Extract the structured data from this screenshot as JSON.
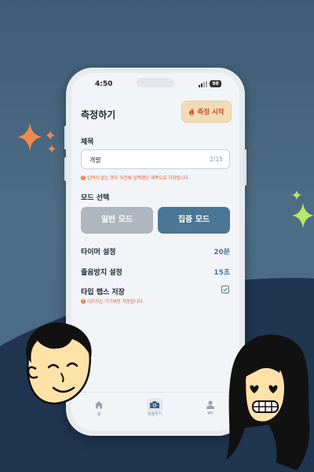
{
  "status": {
    "time": "4:50",
    "battery": "98"
  },
  "header": {
    "title": "측정하기",
    "start_button": "측정 시작"
  },
  "title_section": {
    "label": "제목",
    "value": "개발",
    "count": "2/15",
    "hint": "입력이 없는 경우 이전에 입력했던 제목으로 저장됩니다."
  },
  "mode_section": {
    "label": "모드 선택",
    "normal": "일반 모드",
    "focus": "집중 모드",
    "selected": "focus"
  },
  "settings": {
    "timer": {
      "label": "타이머 설정",
      "value": "20분"
    },
    "drowsy": {
      "label": "졸음방지 설정",
      "value": "15초"
    },
    "timelapse": {
      "label": "타입 랩스 저장",
      "checked": true,
      "hint": "이미지는 기기에만 저장됩니다."
    }
  },
  "tabbar": {
    "home": "홈",
    "measure": "측정하기",
    "my": "MY"
  },
  "colors": {
    "background": "#4a6a84",
    "accent": "#4a7795",
    "start_button_bg": "#f2dcb8",
    "warning": "#e05a2a",
    "sparkle_orange": "#f08a4a",
    "sparkle_green": "#b8e86a"
  }
}
